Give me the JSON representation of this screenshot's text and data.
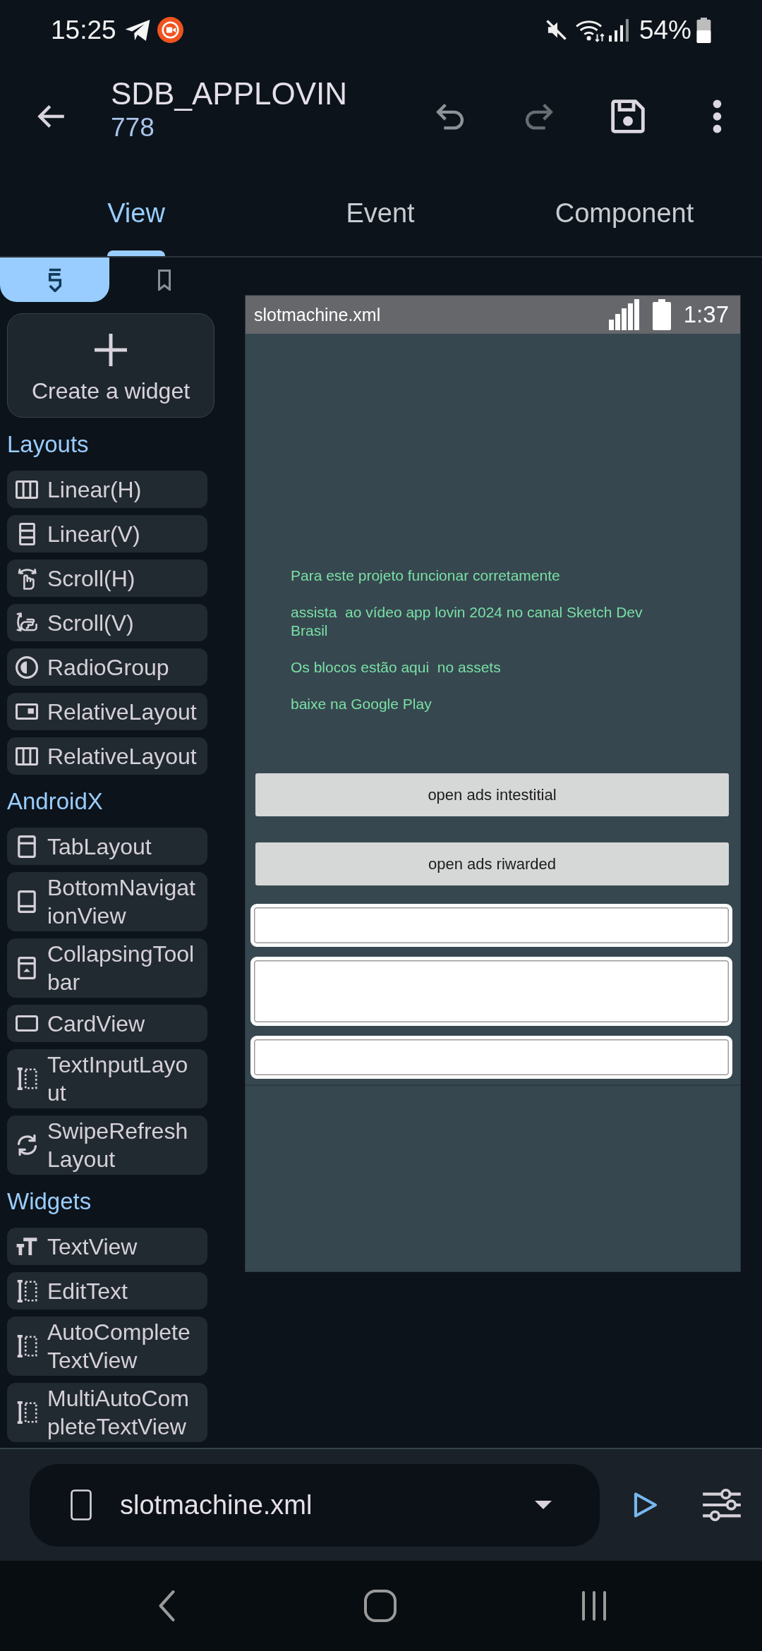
{
  "status_bar": {
    "time": "15:25",
    "battery": "54%"
  },
  "app_bar": {
    "title": "SDB_APPLOVIN",
    "subtitle": "778"
  },
  "tabs": [
    {
      "label": "View",
      "selected": true
    },
    {
      "label": "Event",
      "selected": false
    },
    {
      "label": "Component",
      "selected": false
    }
  ],
  "palette": {
    "tabs": [
      {
        "selected": true
      },
      {
        "selected": false
      }
    ],
    "create_button": "Create a widget",
    "sections": [
      {
        "title": "Layouts",
        "items": [
          "Linear(H)",
          "Linear(V)",
          "Scroll(H)",
          "Scroll(V)",
          "RadioGroup",
          "RelativeLayout",
          "RelativeLayout"
        ]
      },
      {
        "title": "AndroidX",
        "items": [
          "TabLayout",
          "BottomNavigationView",
          "CollapsingToolbar",
          "CardView",
          "TextInputLayout",
          "SwipeRefreshLayout"
        ]
      },
      {
        "title": "Widgets",
        "items": [
          "TextView",
          "EditText",
          "AutoCompleteTextView",
          "MultiAutoCompleteTextView"
        ]
      }
    ]
  },
  "preview": {
    "file_name": "slotmachine.xml",
    "time": "1:37",
    "texts": [
      "Para este projeto funcionar corretamente",
      "assista  ao vídeo app lovin 2024 no canal Sketch Dev Brasil",
      "Os blocos estão aqui  no assets",
      "baixe na Google Play"
    ],
    "buttons": [
      "open ads intestitial",
      "open ads riwarded"
    ],
    "edit_texts": [
      {
        "kind": "single"
      },
      {
        "kind": "multiline"
      },
      {
        "kind": "single"
      }
    ]
  },
  "bottom_bar": {
    "file_selector": "slotmachine.xml"
  }
}
